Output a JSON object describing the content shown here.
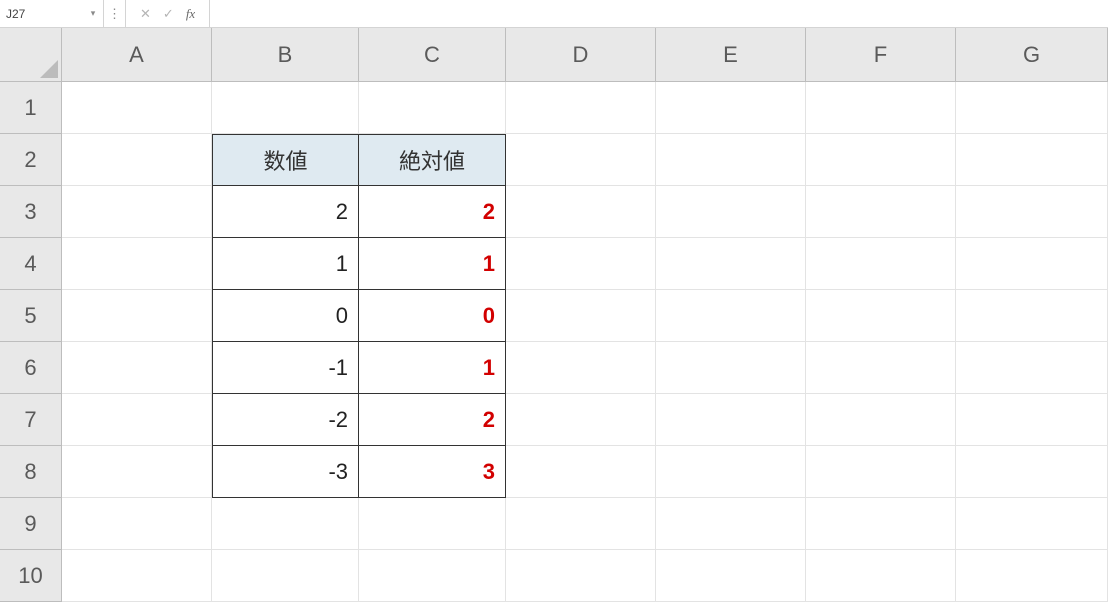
{
  "formula_bar": {
    "cell_ref": "J27",
    "cancel_glyph": "✕",
    "enter_glyph": "✓",
    "fx_label": "fx",
    "formula_value": ""
  },
  "columns": [
    "A",
    "B",
    "C",
    "D",
    "E",
    "F",
    "G"
  ],
  "rows": [
    "1",
    "2",
    "3",
    "4",
    "5",
    "6",
    "7",
    "8",
    "9",
    "10"
  ],
  "sheet_data": {
    "B2": "数値",
    "C2": "絶対値",
    "B3": "2",
    "C3": "2",
    "B4": "1",
    "C4": "1",
    "B5": "0",
    "C5": "0",
    "B6": "-1",
    "C6": "1",
    "B7": "-2",
    "C7": "2",
    "B8": "-3",
    "C8": "3"
  }
}
